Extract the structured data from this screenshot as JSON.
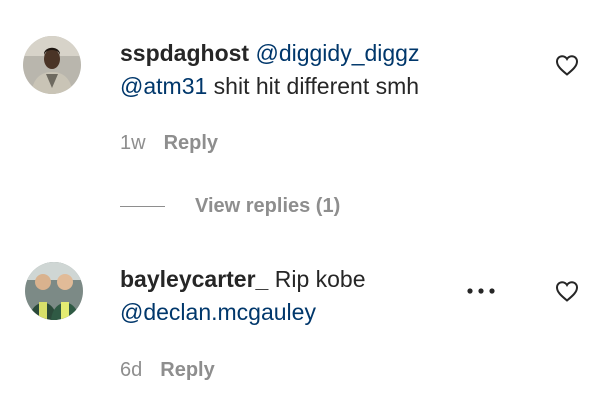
{
  "comments": [
    {
      "username": "sspdaghost",
      "mention_1": "@diggidy_diggz",
      "mention_2": "@atm31",
      "body": "shit hit different smh",
      "time": "1w",
      "reply_label": "Reply",
      "view_replies_label": "View replies (1)"
    },
    {
      "username": "bayleycarter_",
      "body": "Rip kobe",
      "mention_1": "@declan.mcgauley",
      "time": "6d",
      "reply_label": "Reply"
    }
  ],
  "icons": {
    "like": "heart-outline-icon",
    "more": "more-options-icon"
  },
  "colors": {
    "text": "#262626",
    "secondary": "#8e8e8e",
    "link": "#00376b"
  }
}
